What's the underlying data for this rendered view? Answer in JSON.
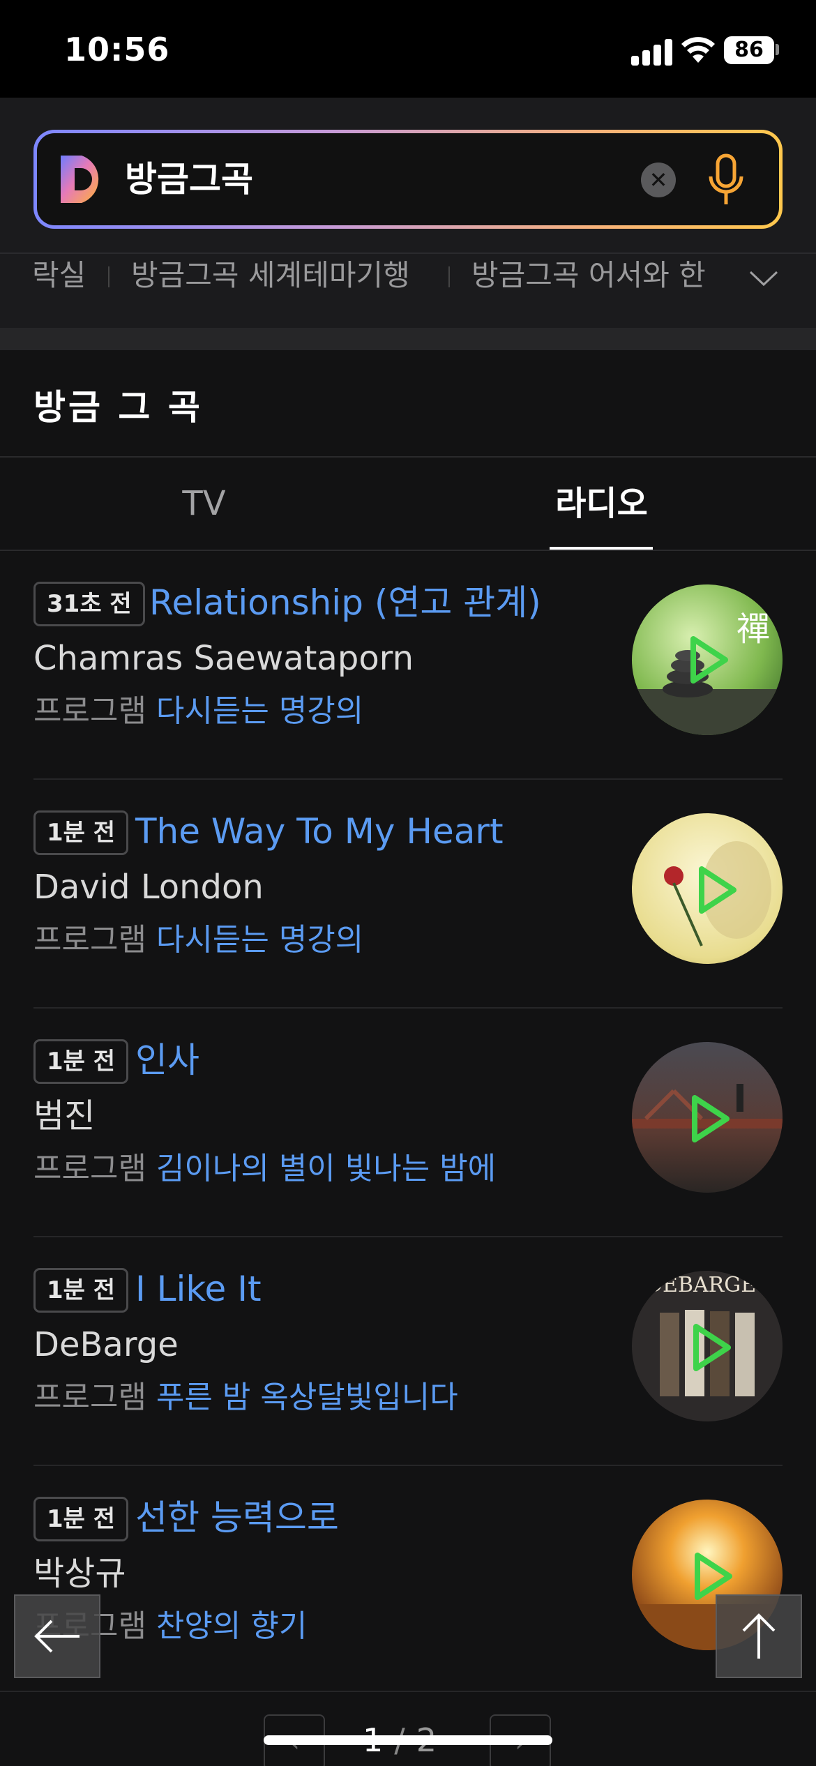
{
  "status_bar": {
    "time": "10:56",
    "battery": "86"
  },
  "search": {
    "query": "방금그곡"
  },
  "chips": [
    "락실",
    "방금그곡 세계테마기행",
    "방금그곡 어서와 한"
  ],
  "section": {
    "title": "방금 그 곡"
  },
  "tabs": [
    {
      "label": "TV"
    },
    {
      "label": "라디오"
    }
  ],
  "items": [
    {
      "time": "31초 전",
      "title": "Relationship (연고 관계)",
      "artist": "Chamras Saewataporn",
      "program_label": "프로그램",
      "program": "다시듣는 명강의"
    },
    {
      "time": "1분 전",
      "title": "The Way To My Heart",
      "artist": "David London",
      "program_label": "프로그램",
      "program": "다시듣는 명강의"
    },
    {
      "time": "1분 전",
      "title": "인사",
      "artist": "범진",
      "program_label": "프로그램",
      "program": "김이나의 별이 빛나는 밤에"
    },
    {
      "time": "1분 전",
      "title": "I Like It",
      "artist": "DeBarge",
      "program_label": "프로그램",
      "program": "푸른 밤 옥상달빛입니다"
    },
    {
      "time": "1분 전",
      "title": "선한 능력으로",
      "artist": "박상규",
      "program_label": "프로그램",
      "program": "찬양의 향기"
    }
  ],
  "pagination": {
    "current": "1",
    "separator": "/",
    "total": "2"
  },
  "colors": {
    "accent_blue": "#5b9bf2",
    "play_green": "#3ed34a",
    "background": "#121213"
  }
}
